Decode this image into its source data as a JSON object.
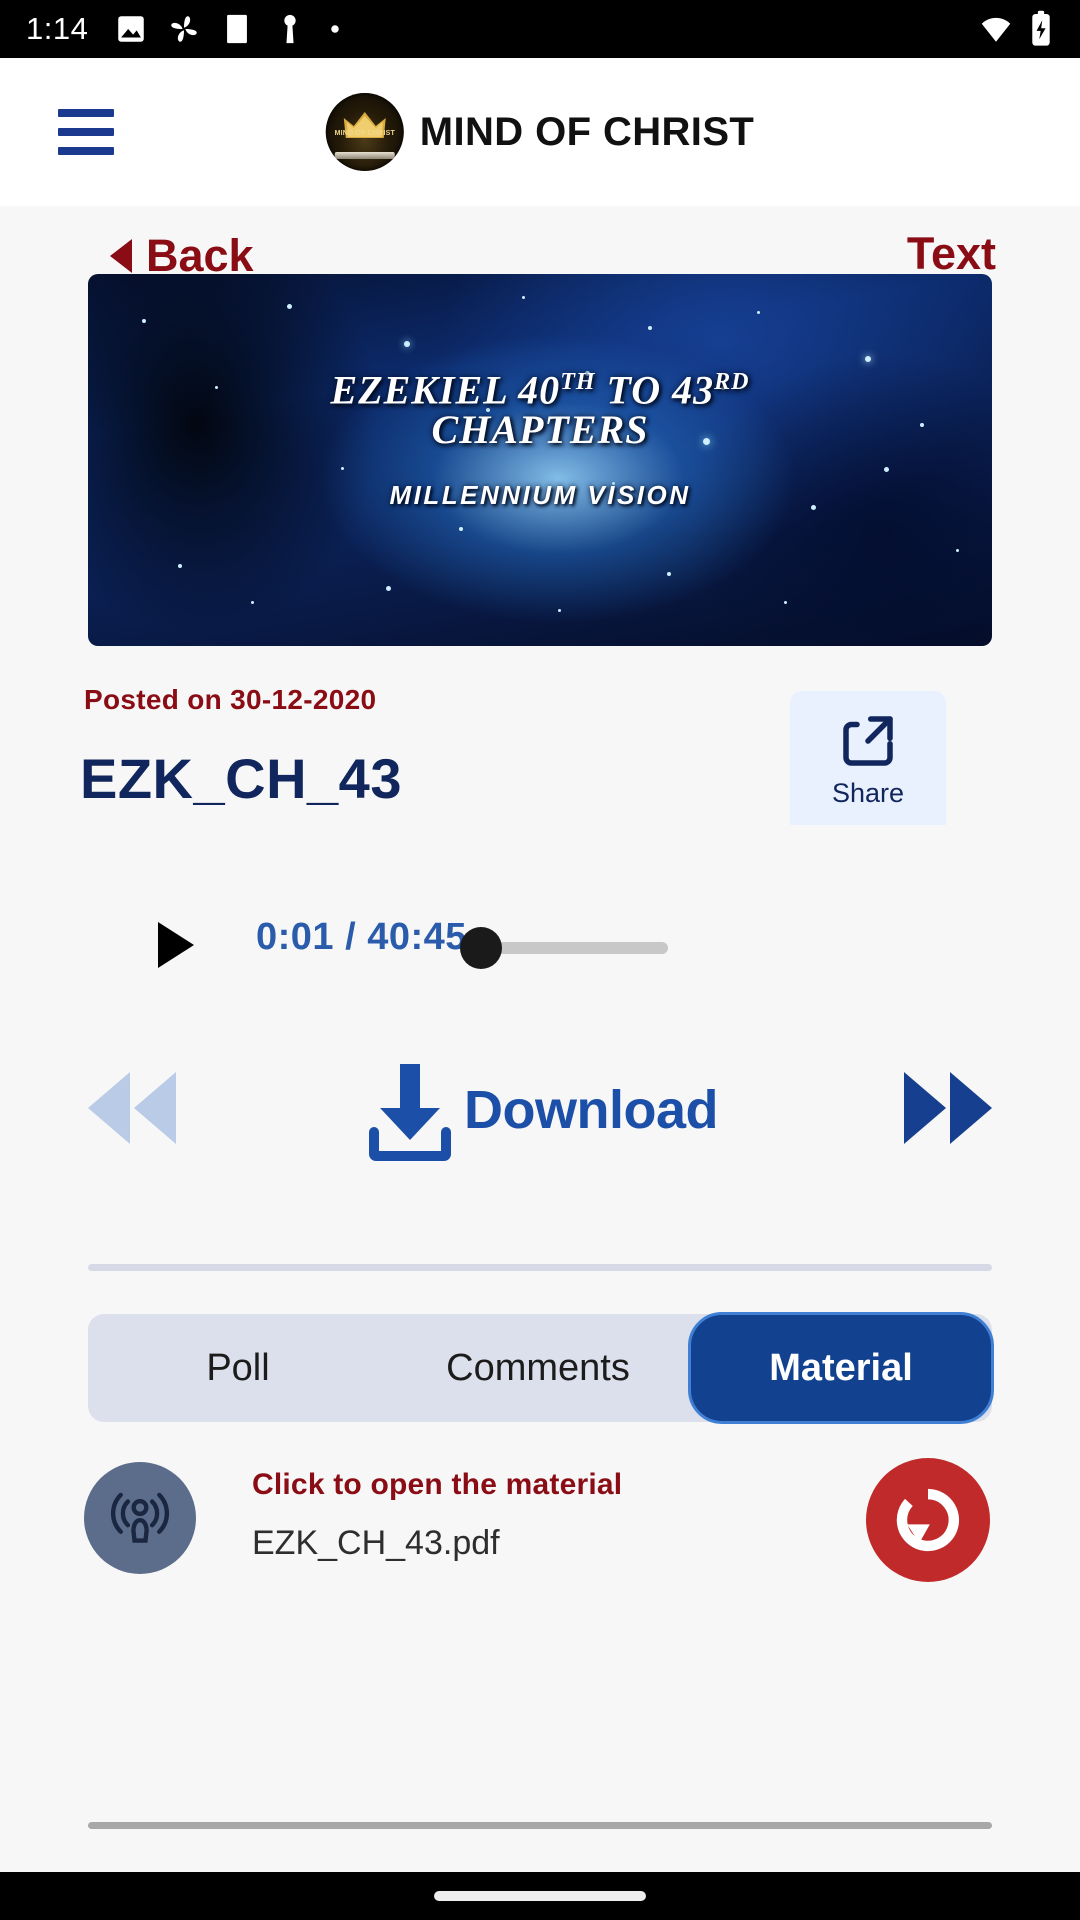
{
  "status_bar": {
    "time": "1:14",
    "left_icons": [
      "image-icon",
      "photos-pinwheel-icon",
      "white-square-icon",
      "key-icon",
      "dot-icon"
    ],
    "right_icons": [
      "wifi-icon",
      "battery-charging-icon"
    ]
  },
  "header": {
    "menu_icon": "hamburger-menu-icon",
    "logo_alt": "mind-of-christ-logo",
    "logo_ribbon_text": "MIND OF CHRIST",
    "title": "MIND OF CHRIST"
  },
  "nav": {
    "back_label": "Back",
    "back_icon": "left-triangle-icon",
    "text_link_label": "Text"
  },
  "thumbnail": {
    "title_line1_a": "EZEKIEL 40",
    "title_line1_sup1": "TH",
    "title_line1_b": " TO 43",
    "title_line1_sup2": "RD",
    "title_line2": "CHAPTERS",
    "subtitle": "MILLENNIUM VISION"
  },
  "meta": {
    "posted": "Posted on 30-12-2020",
    "title": "EZK_CH_43",
    "share_label": "Share",
    "share_icon": "share-icon"
  },
  "player": {
    "play_icon": "play-icon",
    "timecode": "0:01 / 40:45",
    "current_time": "0:01",
    "total_time": "40:45",
    "progress_percent": 0.04
  },
  "transport": {
    "prev_icon": "rewind-icon",
    "next_icon": "fast-forward-icon",
    "download_label": "Download",
    "download_icon": "download-icon"
  },
  "tabs": [
    {
      "label": "Poll",
      "active": false
    },
    {
      "label": "Comments",
      "active": false
    },
    {
      "label": "Material",
      "active": true
    }
  ],
  "material": {
    "podcast_icon": "podcast-icon",
    "cta": "Click to open the material",
    "file_name": "EZK_CH_43.pdf",
    "refresh_icon": "refresh-icon"
  },
  "colors": {
    "accent_red": "#8a0c14",
    "accent_navy": "#10265c",
    "tab_active": "#11418f",
    "refresh_red": "#c02a2a",
    "download_blue": "#1c4fa8",
    "timecode_blue": "#2a5cab"
  }
}
